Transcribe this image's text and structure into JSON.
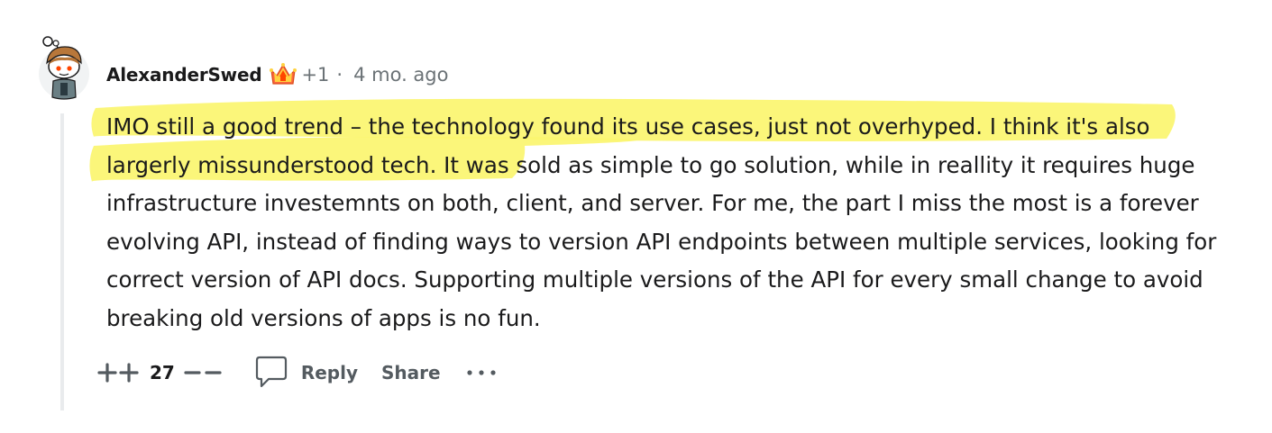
{
  "comment": {
    "author": "AlexanderSwed",
    "points": "+1",
    "separator": "·",
    "time": "4 mo. ago",
    "text_highlighted": "IMO still a good trend – the technology found its use cases, just not overhyped. I think it's also largerly missunderstood tech.",
    "text_rest": " It was sold as simple to go solution, while in reallity it requires huge infrastructure investemnts on both, client, and server. For me, the part I miss the most is a forever evolving API, instead of finding ways to version API endpoints between multiple services, looking for correct version of API docs. Supporting multiple versions of the API for every small change to avoid breaking old versions of apps is no fun.",
    "highlight_color": "#fbf56f"
  },
  "actions": {
    "score": "27",
    "reply_label": "Reply",
    "share_label": "Share"
  },
  "icons": {
    "avatar": "snoo-avatar-icon",
    "flair": "crown-flair-icon",
    "upvote": "upvote-icon",
    "downvote": "downvote-icon",
    "reply": "speech-bubble-icon",
    "more": "more-dots-icon"
  }
}
